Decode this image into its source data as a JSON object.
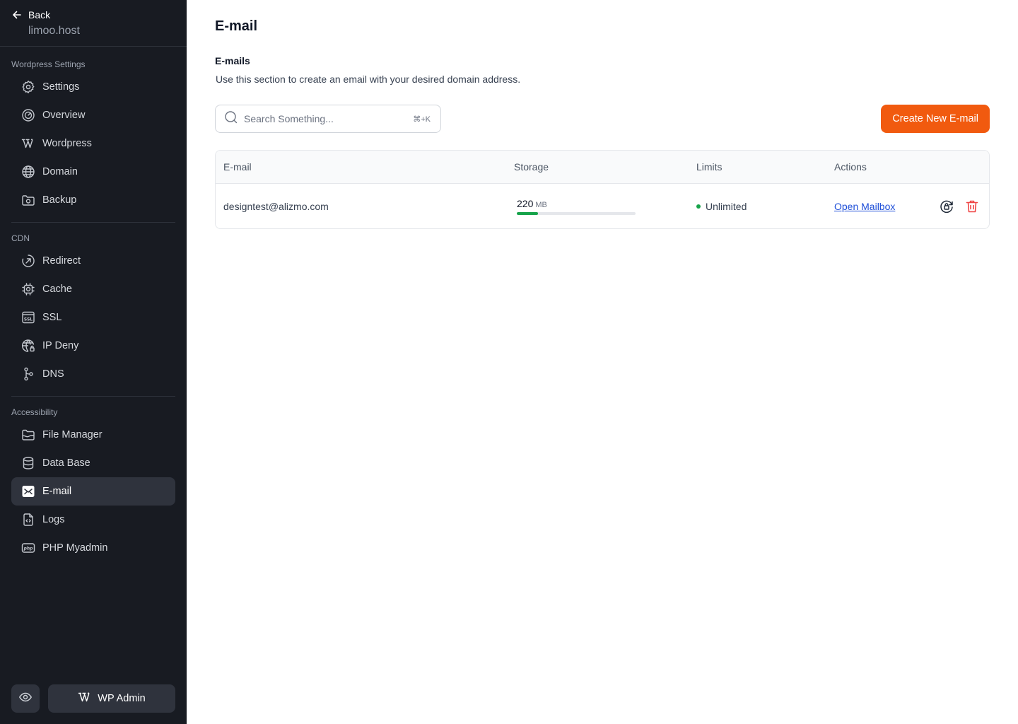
{
  "sidebar": {
    "back_label": "Back",
    "host": "limoo.host",
    "sections": [
      {
        "title": "Wordpress Settings",
        "items": [
          {
            "label": "Settings",
            "icon": "gear-icon"
          },
          {
            "label": "Overview",
            "icon": "gauge-icon"
          },
          {
            "label": "Wordpress",
            "icon": "wordpress-icon"
          },
          {
            "label": "Domain",
            "icon": "globe-icon"
          },
          {
            "label": "Backup",
            "icon": "backup-folder-icon"
          }
        ]
      },
      {
        "title": "CDN",
        "items": [
          {
            "label": "Redirect",
            "icon": "redirect-icon"
          },
          {
            "label": "Cache",
            "icon": "chip-icon"
          },
          {
            "label": "SSL",
            "icon": "ssl-icon"
          },
          {
            "label": "IP Deny",
            "icon": "globe-lock-icon"
          },
          {
            "label": "DNS",
            "icon": "dns-nodes-icon"
          }
        ]
      },
      {
        "title": "Accessibility",
        "items": [
          {
            "label": "File Manager",
            "icon": "folder-icon"
          },
          {
            "label": "Data Base",
            "icon": "database-icon"
          },
          {
            "label": "E-mail",
            "icon": "mail-icon",
            "active": true
          },
          {
            "label": "Logs",
            "icon": "code-file-icon"
          },
          {
            "label": "PHP Myadmin",
            "icon": "php-icon"
          }
        ]
      }
    ],
    "footer": {
      "wp_admin_label": "WP Admin"
    }
  },
  "main": {
    "page_title": "E-mail",
    "section_title": "E-mails",
    "section_description": "Use this section to create an email with your desired domain address.",
    "search": {
      "placeholder": "Search Something...",
      "shortcut": "⌘+K"
    },
    "create_button_label": "Create New E-mail",
    "table": {
      "columns": [
        "E-mail",
        "Storage",
        "Limits",
        "Actions"
      ],
      "rows": [
        {
          "email": "designtest@alizmo.com",
          "storage_value": "220",
          "storage_unit": "MB",
          "storage_fraction": 0.18,
          "limit": "Unlimited",
          "action_link": "Open Mailbox"
        }
      ]
    }
  },
  "colors": {
    "sidebar_bg": "#181b22",
    "accent": "#f15a0f",
    "success": "#16a34a",
    "danger": "#ef4444",
    "link": "#1d4ed8"
  }
}
